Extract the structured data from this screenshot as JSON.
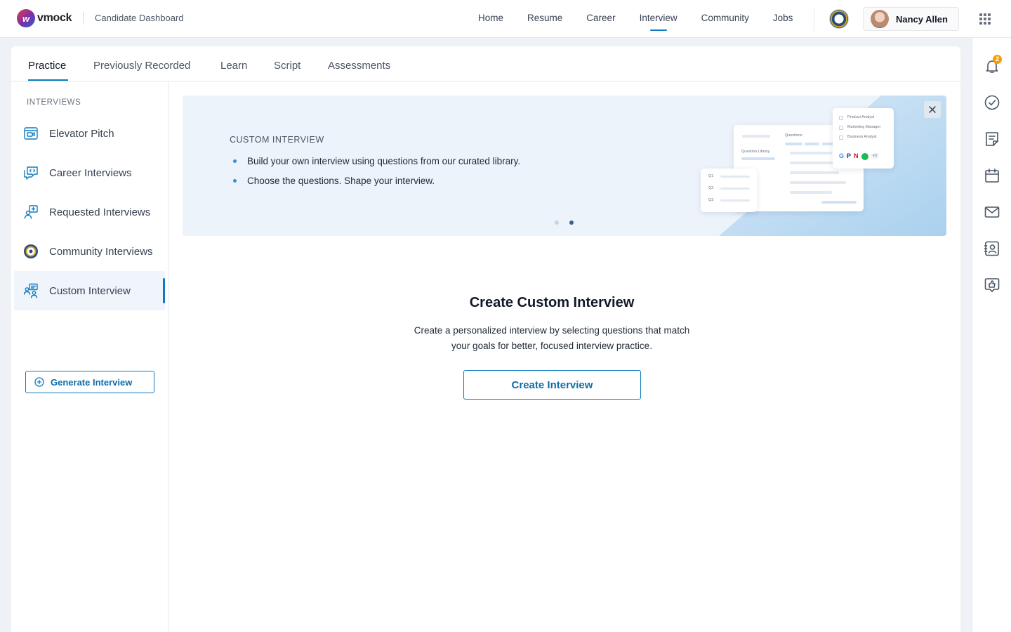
{
  "header": {
    "logo_text": "vmock",
    "app_title": "Candidate Dashboard",
    "nav": [
      "Home",
      "Resume",
      "Career",
      "Interview",
      "Community",
      "Jobs"
    ],
    "active_nav": "Interview",
    "user_name": "Nancy Allen"
  },
  "rail": {
    "notification_count": "2",
    "icons": [
      "bell-icon",
      "check-circle-icon",
      "notes-icon",
      "calendar-icon",
      "mail-icon",
      "contact-card-icon",
      "feedback-icon"
    ]
  },
  "tabs": {
    "items": [
      "Practice",
      "Previously Recorded",
      "Learn",
      "Script",
      "Assessments"
    ],
    "active": "Practice"
  },
  "sidebar": {
    "heading": "INTERVIEWS",
    "items": [
      {
        "label": "Elevator Pitch",
        "icon": "video-icon"
      },
      {
        "label": "Career Interviews",
        "icon": "chat-code-icon"
      },
      {
        "label": "Requested Interviews",
        "icon": "person-add-icon"
      },
      {
        "label": "Community Interviews",
        "icon": "community-emblem-icon"
      },
      {
        "label": "Custom Interview",
        "icon": "custom-users-icon"
      }
    ],
    "active": "Custom Interview",
    "generate_button": "Generate Interview"
  },
  "banner": {
    "kicker": "CUSTOM INTERVIEW",
    "bullets": [
      "Build your own interview using questions from our curated library.",
      "Choose the questions. Shape your interview."
    ],
    "mockup": {
      "roles": [
        "Product Analyst",
        "Marketing Manager",
        "Business Analyst"
      ],
      "brands": [
        "G",
        "P",
        "N"
      ],
      "more": "+2",
      "questions_label": "Questions",
      "library_label": "Question Library",
      "q_items": [
        "Q1",
        "Q2",
        "Q3"
      ]
    },
    "active_slide": 2,
    "slides": 2
  },
  "empty_state": {
    "title": "Create Custom Interview",
    "description": "Create a personalized interview by selecting questions that match your goals for better, focused interview practice.",
    "button": "Create Interview"
  },
  "colors": {
    "accent": "#0e7abf",
    "badge": "#f59e0b",
    "banner_bg": "#edf3fa"
  }
}
